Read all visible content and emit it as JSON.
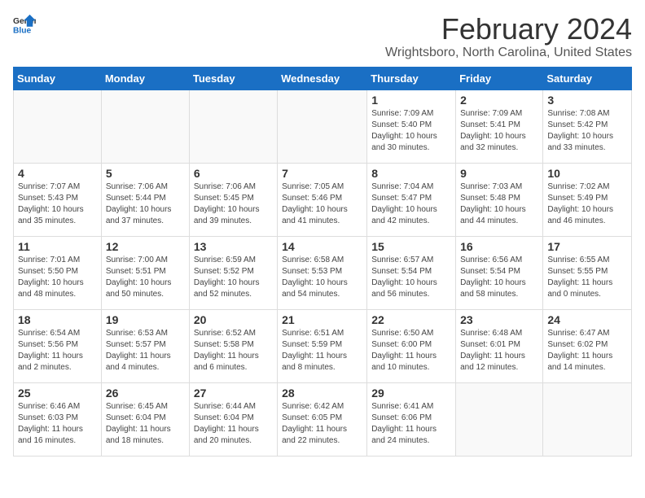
{
  "logo": {
    "general": "General",
    "blue": "Blue"
  },
  "header": {
    "title": "February 2024",
    "subtitle": "Wrightsboro, North Carolina, United States"
  },
  "days_of_week": [
    "Sunday",
    "Monday",
    "Tuesday",
    "Wednesday",
    "Thursday",
    "Friday",
    "Saturday"
  ],
  "weeks": [
    [
      {
        "day": null,
        "sunrise": null,
        "sunset": null,
        "daylight": null
      },
      {
        "day": null,
        "sunrise": null,
        "sunset": null,
        "daylight": null
      },
      {
        "day": null,
        "sunrise": null,
        "sunset": null,
        "daylight": null
      },
      {
        "day": null,
        "sunrise": null,
        "sunset": null,
        "daylight": null
      },
      {
        "day": "1",
        "sunrise": "7:09 AM",
        "sunset": "5:40 PM",
        "daylight": "10 hours and 30 minutes."
      },
      {
        "day": "2",
        "sunrise": "7:09 AM",
        "sunset": "5:41 PM",
        "daylight": "10 hours and 32 minutes."
      },
      {
        "day": "3",
        "sunrise": "7:08 AM",
        "sunset": "5:42 PM",
        "daylight": "10 hours and 33 minutes."
      }
    ],
    [
      {
        "day": "4",
        "sunrise": "7:07 AM",
        "sunset": "5:43 PM",
        "daylight": "10 hours and 35 minutes."
      },
      {
        "day": "5",
        "sunrise": "7:06 AM",
        "sunset": "5:44 PM",
        "daylight": "10 hours and 37 minutes."
      },
      {
        "day": "6",
        "sunrise": "7:06 AM",
        "sunset": "5:45 PM",
        "daylight": "10 hours and 39 minutes."
      },
      {
        "day": "7",
        "sunrise": "7:05 AM",
        "sunset": "5:46 PM",
        "daylight": "10 hours and 41 minutes."
      },
      {
        "day": "8",
        "sunrise": "7:04 AM",
        "sunset": "5:47 PM",
        "daylight": "10 hours and 42 minutes."
      },
      {
        "day": "9",
        "sunrise": "7:03 AM",
        "sunset": "5:48 PM",
        "daylight": "10 hours and 44 minutes."
      },
      {
        "day": "10",
        "sunrise": "7:02 AM",
        "sunset": "5:49 PM",
        "daylight": "10 hours and 46 minutes."
      }
    ],
    [
      {
        "day": "11",
        "sunrise": "7:01 AM",
        "sunset": "5:50 PM",
        "daylight": "10 hours and 48 minutes."
      },
      {
        "day": "12",
        "sunrise": "7:00 AM",
        "sunset": "5:51 PM",
        "daylight": "10 hours and 50 minutes."
      },
      {
        "day": "13",
        "sunrise": "6:59 AM",
        "sunset": "5:52 PM",
        "daylight": "10 hours and 52 minutes."
      },
      {
        "day": "14",
        "sunrise": "6:58 AM",
        "sunset": "5:53 PM",
        "daylight": "10 hours and 54 minutes."
      },
      {
        "day": "15",
        "sunrise": "6:57 AM",
        "sunset": "5:54 PM",
        "daylight": "10 hours and 56 minutes."
      },
      {
        "day": "16",
        "sunrise": "6:56 AM",
        "sunset": "5:54 PM",
        "daylight": "10 hours and 58 minutes."
      },
      {
        "day": "17",
        "sunrise": "6:55 AM",
        "sunset": "5:55 PM",
        "daylight": "11 hours and 0 minutes."
      }
    ],
    [
      {
        "day": "18",
        "sunrise": "6:54 AM",
        "sunset": "5:56 PM",
        "daylight": "11 hours and 2 minutes."
      },
      {
        "day": "19",
        "sunrise": "6:53 AM",
        "sunset": "5:57 PM",
        "daylight": "11 hours and 4 minutes."
      },
      {
        "day": "20",
        "sunrise": "6:52 AM",
        "sunset": "5:58 PM",
        "daylight": "11 hours and 6 minutes."
      },
      {
        "day": "21",
        "sunrise": "6:51 AM",
        "sunset": "5:59 PM",
        "daylight": "11 hours and 8 minutes."
      },
      {
        "day": "22",
        "sunrise": "6:50 AM",
        "sunset": "6:00 PM",
        "daylight": "11 hours and 10 minutes."
      },
      {
        "day": "23",
        "sunrise": "6:48 AM",
        "sunset": "6:01 PM",
        "daylight": "11 hours and 12 minutes."
      },
      {
        "day": "24",
        "sunrise": "6:47 AM",
        "sunset": "6:02 PM",
        "daylight": "11 hours and 14 minutes."
      }
    ],
    [
      {
        "day": "25",
        "sunrise": "6:46 AM",
        "sunset": "6:03 PM",
        "daylight": "11 hours and 16 minutes."
      },
      {
        "day": "26",
        "sunrise": "6:45 AM",
        "sunset": "6:04 PM",
        "daylight": "11 hours and 18 minutes."
      },
      {
        "day": "27",
        "sunrise": "6:44 AM",
        "sunset": "6:04 PM",
        "daylight": "11 hours and 20 minutes."
      },
      {
        "day": "28",
        "sunrise": "6:42 AM",
        "sunset": "6:05 PM",
        "daylight": "11 hours and 22 minutes."
      },
      {
        "day": "29",
        "sunrise": "6:41 AM",
        "sunset": "6:06 PM",
        "daylight": "11 hours and 24 minutes."
      },
      {
        "day": null,
        "sunrise": null,
        "sunset": null,
        "daylight": null
      },
      {
        "day": null,
        "sunrise": null,
        "sunset": null,
        "daylight": null
      }
    ]
  ]
}
